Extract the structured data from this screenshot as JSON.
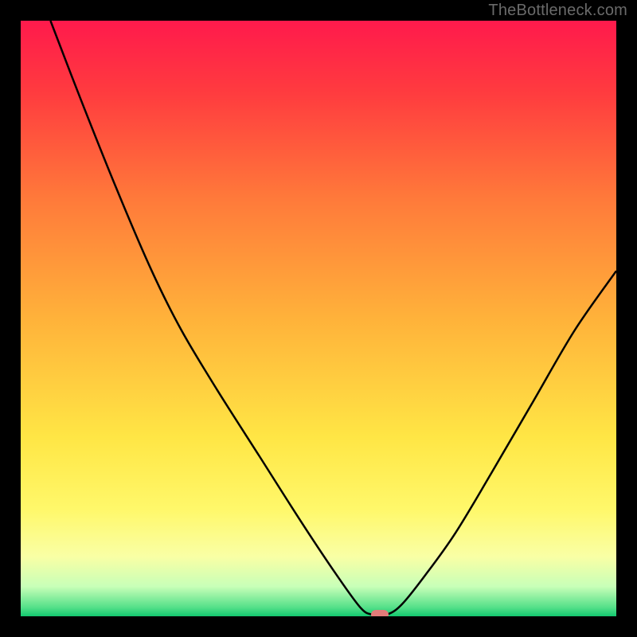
{
  "attribution": "TheBottleneck.com",
  "chart_data": {
    "type": "line",
    "title": "",
    "xlabel": "",
    "ylabel": "",
    "xlim": [
      0,
      100
    ],
    "ylim": [
      0,
      100
    ],
    "legend": false,
    "grid": false,
    "background_gradient": {
      "stops": [
        {
          "pos": 0.0,
          "color": "#ff1a4c"
        },
        {
          "pos": 0.12,
          "color": "#ff3b3f"
        },
        {
          "pos": 0.3,
          "color": "#ff7a3a"
        },
        {
          "pos": 0.5,
          "color": "#ffb23a"
        },
        {
          "pos": 0.7,
          "color": "#ffe645"
        },
        {
          "pos": 0.82,
          "color": "#fff86a"
        },
        {
          "pos": 0.9,
          "color": "#f9ffa5"
        },
        {
          "pos": 0.95,
          "color": "#c8ffb8"
        },
        {
          "pos": 0.985,
          "color": "#55e089"
        },
        {
          "pos": 1.0,
          "color": "#12c86f"
        }
      ]
    },
    "series": [
      {
        "name": "bottleneck-curve",
        "color": "#000000",
        "points": [
          {
            "x": 5.0,
            "y": 100.0
          },
          {
            "x": 10.0,
            "y": 87.0
          },
          {
            "x": 16.0,
            "y": 72.0
          },
          {
            "x": 22.0,
            "y": 58.0
          },
          {
            "x": 27.0,
            "y": 48.0
          },
          {
            "x": 33.0,
            "y": 38.0
          },
          {
            "x": 40.0,
            "y": 27.0
          },
          {
            "x": 47.0,
            "y": 16.0
          },
          {
            "x": 53.0,
            "y": 7.0
          },
          {
            "x": 57.0,
            "y": 1.5
          },
          {
            "x": 59.0,
            "y": 0.3
          },
          {
            "x": 61.5,
            "y": 0.3
          },
          {
            "x": 64.0,
            "y": 2.0
          },
          {
            "x": 68.0,
            "y": 7.0
          },
          {
            "x": 73.0,
            "y": 14.0
          },
          {
            "x": 79.0,
            "y": 24.0
          },
          {
            "x": 86.0,
            "y": 36.0
          },
          {
            "x": 93.0,
            "y": 48.0
          },
          {
            "x": 100.0,
            "y": 58.0
          }
        ]
      }
    ],
    "marker": {
      "name": "optimal-point",
      "x": 60.3,
      "y": 0.3,
      "color": "#e37b79"
    }
  }
}
